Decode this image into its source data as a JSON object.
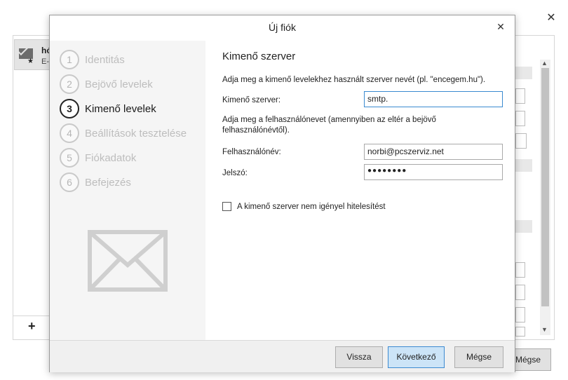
{
  "background": {
    "close_icon": "✕",
    "account": {
      "title": "hó",
      "subtitle": "E-",
      "star_icon": "★"
    },
    "add_icon": "+",
    "cancel_label": "Mégse"
  },
  "dialog": {
    "title": "Új fiók",
    "close_icon": "✕",
    "steps": [
      {
        "num": "1",
        "label": "Identitás",
        "active": false
      },
      {
        "num": "2",
        "label": "Bejövő levelek",
        "active": false
      },
      {
        "num": "3",
        "label": "Kimenő levelek",
        "active": true
      },
      {
        "num": "4",
        "label": "Beállítások tesztelése",
        "active": false
      },
      {
        "num": "5",
        "label": "Fiókadatok",
        "active": false
      },
      {
        "num": "6",
        "label": "Befejezés",
        "active": false
      }
    ],
    "section_title": "Kimenő szerver",
    "server_hint": "Adja meg a kimenő levelekhez használt szerver nevét (pl. \"encegem.hu\").",
    "server_label": "Kimenő szerver:",
    "server_value": "smtp.",
    "username_hint": "Adja meg a felhasználónevet (amennyiben az eltér a bejövő felhasználónévtől).",
    "username_label": "Felhasználónév:",
    "username_value": "norbi@pcszerviz.net",
    "password_label": "Jelszó:",
    "password_value": "●●●●●●●●",
    "no_auth_label": "A kimenő szerver nem igényel hitelesítést",
    "no_auth_checked": false,
    "buttons": {
      "back": "Vissza",
      "next": "Következő",
      "cancel": "Mégse"
    }
  },
  "colors": {
    "primary_button_bg": "#cce4f7",
    "primary_button_border": "#3c8ad1",
    "left_panel_bg": "#f5f5f5"
  }
}
